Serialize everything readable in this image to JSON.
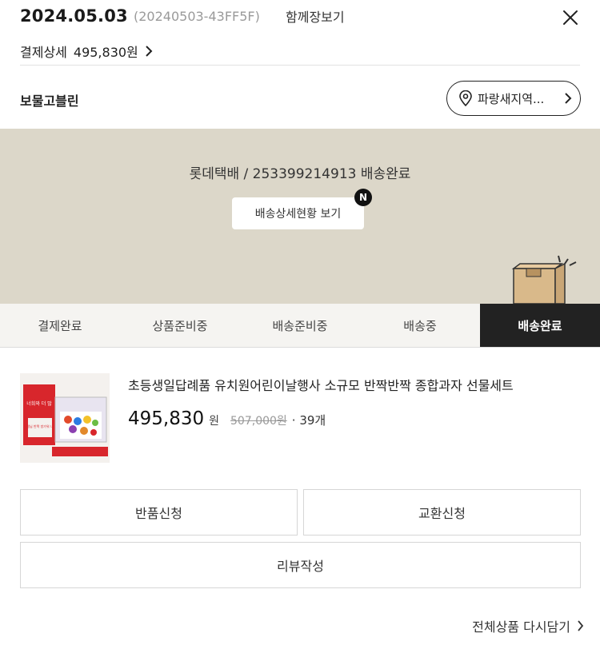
{
  "order": {
    "date": "2024.05.03",
    "code": "(20240503-43FF5F)",
    "view_together": "함께장보기",
    "pay_detail_label": "결제상세",
    "pay_detail_amount": "495,830원"
  },
  "seller": {
    "name": "보물고블린",
    "region_button": "파랑새지역..."
  },
  "shipping": {
    "info": "롯데택배 / 253399214913 배송완료",
    "detail_button": "배송상세현황 보기",
    "new_badge": "N"
  },
  "steps": [
    {
      "label": "결제완료"
    },
    {
      "label": "상품준비중"
    },
    {
      "label": "배송준비중"
    },
    {
      "label": "배송중"
    },
    {
      "label": "배송완료"
    }
  ],
  "active_step": 4,
  "product": {
    "name": "초등생일답례품 유치원어린이날행사 소규모 반짝반짝 종합과자 선물세트",
    "price": "495,830",
    "currency": "원",
    "original_price": "507,000원",
    "quantity": "· 39개",
    "thumb_text_1": "너희와 더 많",
    "thumb_text_2": "선생님 반짝 방가워 나랑"
  },
  "actions": {
    "return": "반품신청",
    "exchange": "교환신청",
    "review": "리뷰작성"
  },
  "reorder_all": "전체상품 다시담기",
  "colors": {
    "banner_bg": "#dcd7c9",
    "active_step_bg": "#222222",
    "box_color": "#d9b98a"
  }
}
